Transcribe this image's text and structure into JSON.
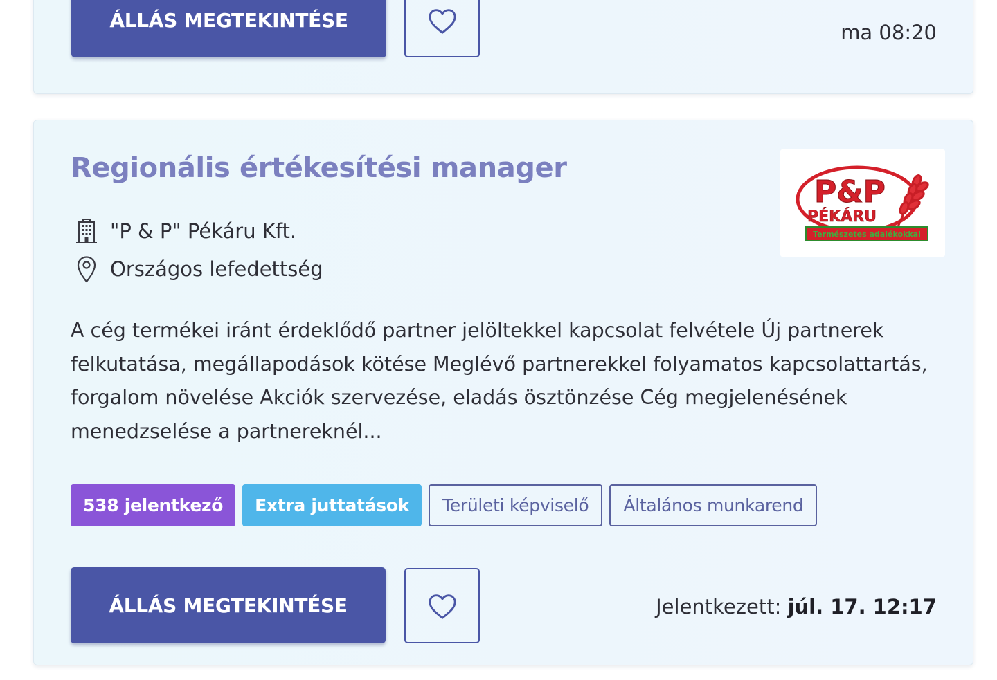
{
  "previous_card": {
    "view_button_label": "ÁLLÁS MEGTEKINTÉSE",
    "timestamp": "ma 08:20"
  },
  "job": {
    "title": "Regionális értékesítési manager",
    "company": "\"P & P\" Pékáru Kft.",
    "location": "Országos lefedettség",
    "description": "A cég termékei iránt érdeklődő partner jelöltekkel kapcsolat felvétele Új partnerek felkutatása, megállapodások kötése Meglévő partnerekkel folyamatos kapcsolattartás, forgalom növelése Akciók szervezése, eladás ösztönzése Cég megjelenésének menedzselése a partnereknél...",
    "tags": {
      "applicants": "538 jelentkező",
      "benefits": "Extra juttatások",
      "role": "Területi képviselő",
      "schedule": "Általános munkarend"
    },
    "view_button_label": "ÁLLÁS MEGTEKINTÉSE",
    "applied_label": "Jelentkezett:",
    "applied_date": "júl. 17. 12:17",
    "logo": {
      "brand": "P&P",
      "name": "PÉKÁRU",
      "slogan": "Természetes adalékokkal"
    }
  },
  "icons": {
    "company": "building-icon",
    "location": "map-pin-icon",
    "favorite": "heart-icon"
  },
  "colors": {
    "primary": "#4a56a6",
    "title": "#7b80bf",
    "applicants_tag": "#8a55d8",
    "benefits_tag": "#4fb6ea",
    "card_bg": "#ecf7fb",
    "logo_red": "#d4202a"
  }
}
